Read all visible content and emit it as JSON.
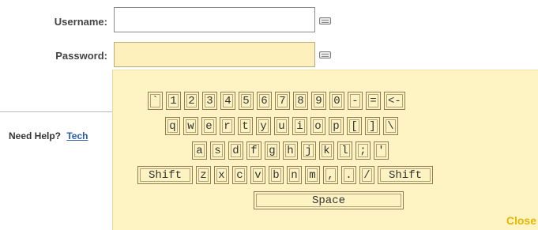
{
  "form": {
    "username_label": "Username:",
    "username_value": "",
    "password_label": "Password:",
    "password_value": ""
  },
  "help": {
    "text": "Need Help?",
    "link": "Tech"
  },
  "keyboard": {
    "rows": [
      [
        "`",
        "1",
        "2",
        "3",
        "4",
        "5",
        "6",
        "7",
        "8",
        "9",
        "0",
        "-",
        "=",
        "<-"
      ],
      [
        "q",
        "w",
        "e",
        "r",
        "t",
        "y",
        "u",
        "i",
        "o",
        "p",
        "[",
        "]",
        "\\"
      ],
      [
        "a",
        "s",
        "d",
        "f",
        "g",
        "h",
        "j",
        "k",
        "l",
        ";",
        "'"
      ],
      [
        "Shift",
        "z",
        "x",
        "c",
        "v",
        "b",
        "n",
        "m",
        ",",
        ".",
        "/",
        "Shift"
      ],
      [
        "Space"
      ]
    ],
    "close_label": "Close"
  },
  "colors": {
    "keyboard_bg": "#fef4c3",
    "close": "#e6b600",
    "link": "#2a5db0"
  },
  "icons": {
    "keyboard_toggle": "keyboard-icon"
  }
}
